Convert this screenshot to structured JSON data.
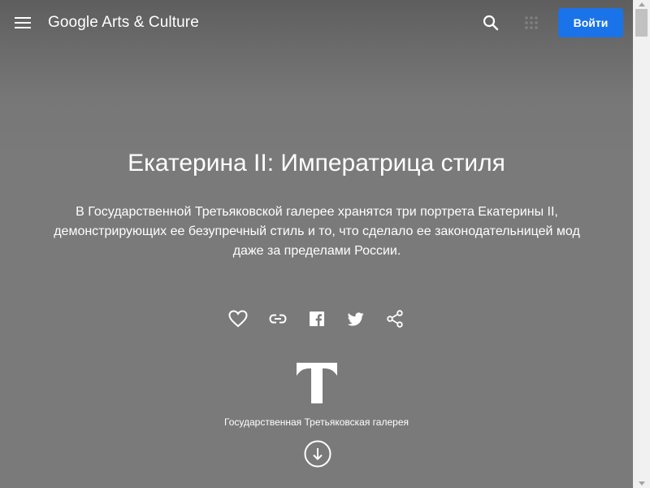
{
  "header": {
    "logo": "Google Arts & Culture",
    "login_label": "Войти"
  },
  "icons": {
    "menu": "hamburger-menu",
    "search": "magnifier",
    "apps": "apps-grid",
    "like": "heart-outline",
    "link": "chain-link",
    "facebook": "facebook-f",
    "twitter": "twitter-bird",
    "share": "share-nodes",
    "scroll_down": "arrow-down-circle"
  },
  "story": {
    "title": "Екатерина II: Императрица стиля",
    "description_lines": [
      "В Государственной Третьяковской галерее хранятся три портрета Екатерины II,",
      "демонстрирующих ее безупречный стиль и то, что сделало ее законодательницей мод",
      "даже за пределами России."
    ]
  },
  "partner": {
    "name": "Государственная Третьяковская галерея"
  },
  "colors": {
    "accent": "#1a73e8",
    "background": "#7a7a7a",
    "text": "#ffffff"
  }
}
